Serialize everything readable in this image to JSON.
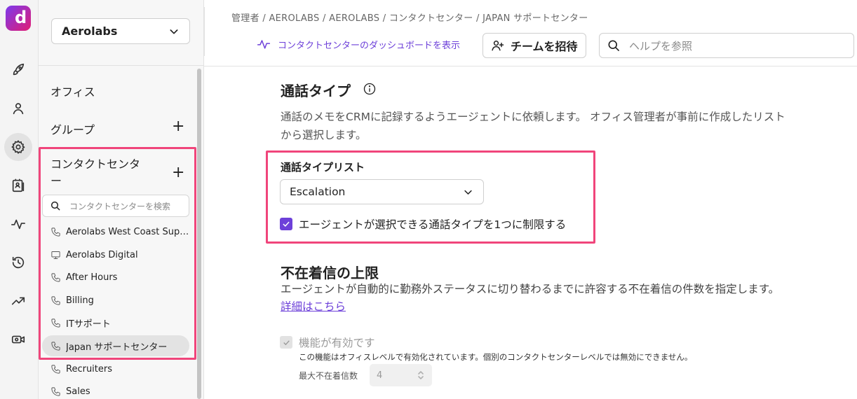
{
  "colors": {
    "accent": "#6d40d9",
    "highlight": "#f0457b",
    "brand_gradient": [
      "#7c3aed",
      "#e11d74"
    ]
  },
  "logo": {
    "letter": "d"
  },
  "rail": {
    "icons": [
      "rocket-icon",
      "user-icon",
      "gear-icon",
      "contacts-icon",
      "activity-icon",
      "history-icon",
      "trend-icon",
      "video-icon"
    ],
    "active": "gear-icon"
  },
  "sidebar": {
    "workspace": "Aerolabs",
    "office_label": "オフィス",
    "group_label": "グループ",
    "contact_center_label": "コンタクトセンター",
    "search_placeholder": "コンタクトセンターを検索",
    "items": [
      {
        "label": "Aerolabs West Coast Support",
        "icon": "phone-icon"
      },
      {
        "label": "Aerolabs Digital",
        "icon": "monitor-icon"
      },
      {
        "label": "After Hours",
        "icon": "phone-icon"
      },
      {
        "label": "Billing",
        "icon": "phone-icon"
      },
      {
        "label": "ITサポート",
        "icon": "phone-icon"
      },
      {
        "label": "Japan サポートセンター",
        "icon": "phone-icon",
        "active": true
      },
      {
        "label": "Recruiters",
        "icon": "phone-icon"
      },
      {
        "label": "Sales",
        "icon": "phone-icon"
      }
    ]
  },
  "header": {
    "breadcrumb": "管理者 / AEROLABS / AEROLABS / コンタクトセンター / JAPAN サポートセンター",
    "dashboard_link": "コンタクトセンターのダッシュボードを表示",
    "invite_button": "チームを招待",
    "help_placeholder": "ヘルプを参照"
  },
  "main": {
    "call_type_title": "通話タイプ",
    "call_type_desc_line1": "通話のメモをCRMに記録するようエージェントに依頼します。 オフィス管理者が事前に作成したリスト",
    "call_type_desc_line2": "から選択します。",
    "call_type_list_label": "通話タイプリスト",
    "call_type_selected": "Escalation",
    "restrict_checkbox_label": "エージェントが選択できる通話タイプを1つに制限する",
    "restrict_checked": true,
    "missed_calls_title": "不在着信の上限",
    "missed_calls_desc": "エージェントが自動的に勤務外ステータスに切り替わるまでに許容する不在着信の件数を指定します。",
    "details_link": "詳細はこちら",
    "feature_enabled_label": "機能が有効です",
    "feature_enabled_checked": true,
    "feature_note": "この機能はオフィスレベルで有効化されています。個別のコンタクトセンターレベルでは無効にできません。",
    "max_missed_label": "最大不在着信数",
    "max_missed_value": "4"
  }
}
